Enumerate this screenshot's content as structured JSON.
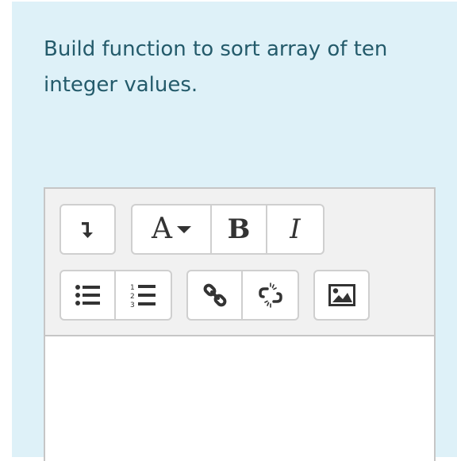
{
  "question": {
    "text": "Build function to sort array of ten integer values."
  },
  "editor": {
    "toolbar": {
      "collapse_icon": "arrow-down-toggle-icon",
      "font_style_label": "A",
      "font_style_icon": "caret-down-icon",
      "bold_label": "B",
      "italic_label": "I",
      "unordered_list_icon": "bulleted-list-icon",
      "ordered_list_icon": "numbered-list-icon",
      "link_icon": "link-icon",
      "unlink_icon": "unlink-icon",
      "image_icon": "image-icon"
    },
    "content_value": ""
  },
  "colors": {
    "panel_bg": "#def1f8",
    "question_text": "#245b6b",
    "toolbar_bg": "#f1f1f1",
    "border": "#c6c6c6"
  }
}
